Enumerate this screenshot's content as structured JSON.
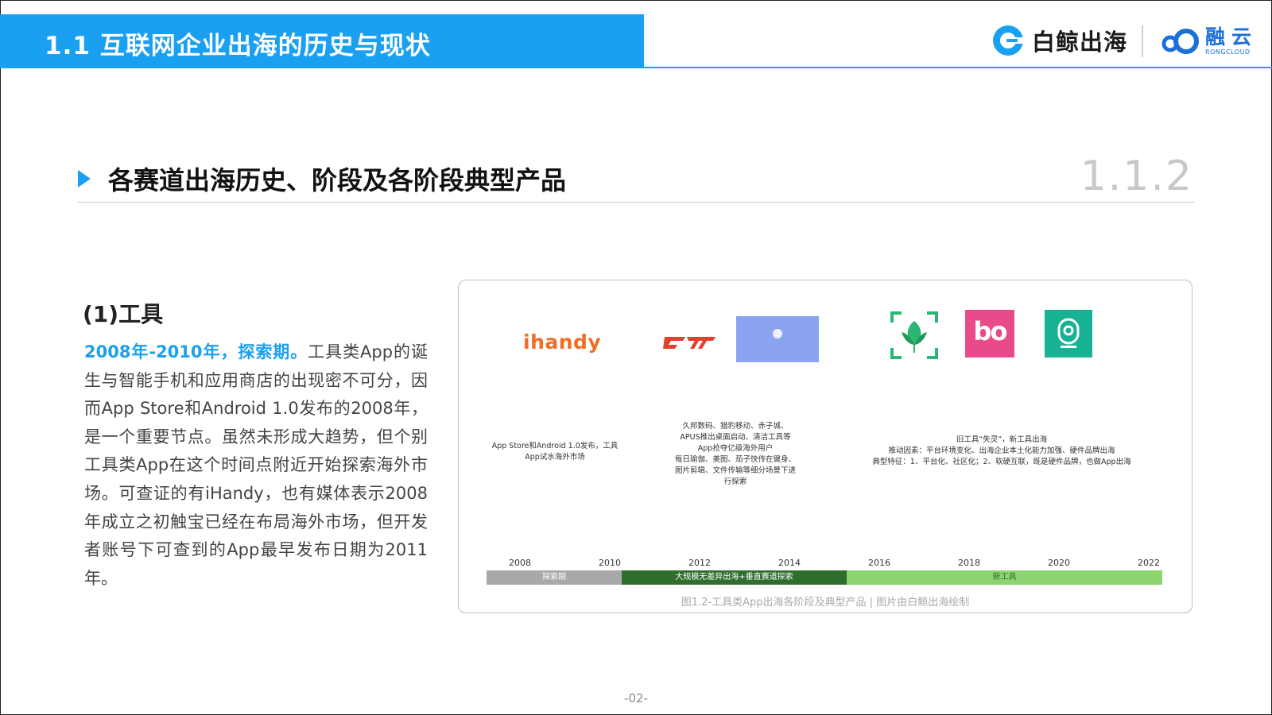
{
  "header": {
    "title": "1.1 互联网企业出海的历史与现状",
    "accent_color": "#1aa0f0",
    "logo_main_text": "白鲸出海",
    "logo_partner_cn": "融云",
    "logo_partner_en": "RONGCLOUD"
  },
  "section": {
    "title": "各赛道出海历史、阶段及各阶段典型产品",
    "number": "1.1.2"
  },
  "content": {
    "subheading": "(1)工具",
    "highlight": "2008年-2010年，探索期。",
    "body": "工具类App的诞生与智能手机和应用商店的出现密不可分，因而App Store和Android 1.0发布的2008年，是一个重要节点。虽然未形成大趋势，但个别工具类App在这个时间点附近开始探索海外市场。可查证的有iHandy，也有媒体表示2008年成立之初触宝已经在布局海外市场，但开发者账号下可查到的App最早发布日期为2011年。"
  },
  "figure": {
    "ihandy_logo_text": "ihandy",
    "pink_logo_text": "bo",
    "note_stage1": [
      "App Store和Android 1.0发布，工具",
      "App试水海外市场"
    ],
    "note_stage2": [
      "久邦数码、猎豹移动、赤子城、",
      "APUS推出桌面启动、清洁工具等",
      "App抢夺亿级海外用户",
      "每日瑜伽、美图、茄子快传在健身、",
      "图片剪辑、文件传输等细分场景下进",
      "行探索"
    ],
    "note_stage3": [
      "旧工具“失灵”，新工具出海",
      "推动因素：平台环境变化、出海企业本土化能力加强、硬件品牌出海",
      "典型特征：1、平台化、社区化；2、软硬互联，既是硬件品牌，也做App出海"
    ],
    "timeline_years": [
      "2008",
      "2010",
      "2012",
      "2014",
      "2016",
      "2018",
      "2020",
      "2022"
    ],
    "timeline_stages": [
      "探索期",
      "大规模无差异出海+垂直赛道探索",
      "新工具"
    ],
    "stage_colors": [
      "#a9a9a9",
      "#2f6e2d",
      "#8bd46f"
    ],
    "caption": "图1.2-工具类App出海各阶段及典型产品 | 图片由白鲸出海绘制"
  },
  "footer": {
    "page_number": "-02-"
  }
}
